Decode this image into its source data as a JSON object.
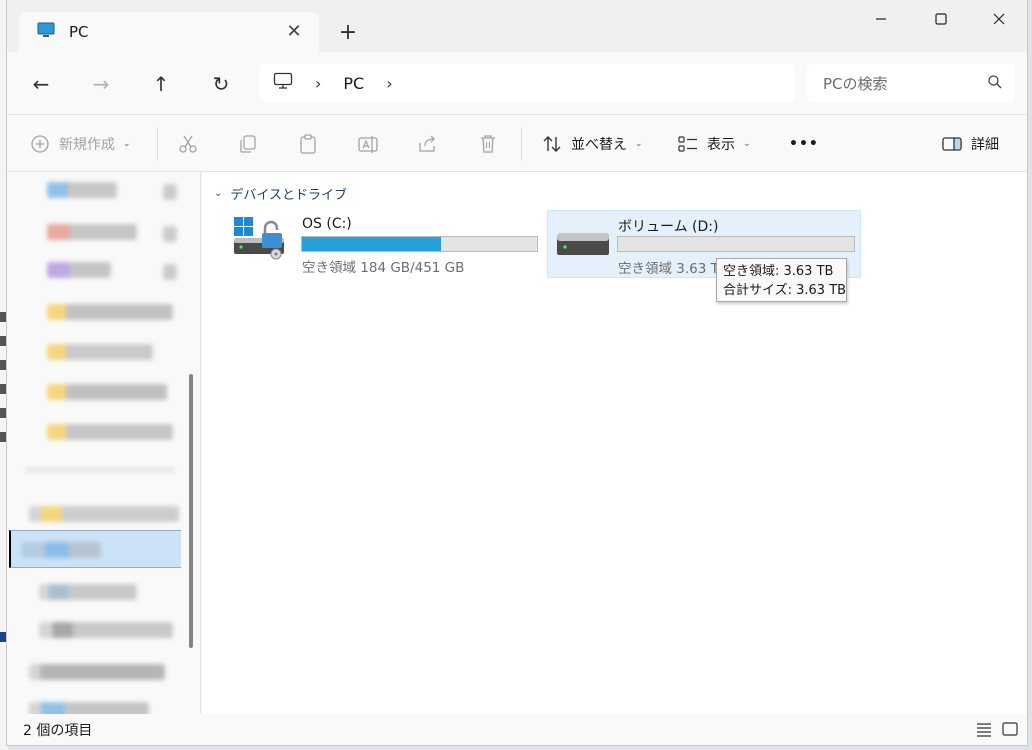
{
  "window": {
    "tab_title": "PC",
    "tab_close": "✕",
    "new_tab": "+",
    "minimize": "—",
    "maximize": "☐",
    "close": "✕"
  },
  "nav": {
    "back": "←",
    "forward": "→",
    "up": "↑",
    "refresh": "↻",
    "breadcrumb": [
      "PC"
    ],
    "search_placeholder": "PCの検索"
  },
  "commands": {
    "new_label": "新規作成",
    "sort_label": "並べ替え",
    "view_label": "表示",
    "more_label": "•••",
    "details_label": "詳細"
  },
  "content": {
    "group_label": "デバイスとドライブ",
    "drives": [
      {
        "name": "OS (C:)",
        "free_text": "空き領域 184 GB/451 GB",
        "used_fraction": 0.59
      },
      {
        "name": "ボリューム (D:)",
        "free_text": "空き領域 3.63 TB",
        "used_fraction": 0.0
      }
    ],
    "tooltip": {
      "line1": "空き領域: 3.63 TB",
      "line2": "合計サイズ: 3.63 TB"
    }
  },
  "status": {
    "item_count": "2 個の項目"
  },
  "colors": {
    "accent": "#26a0da",
    "selection": "#cce3f7",
    "group_header": "#1f3f6e"
  }
}
